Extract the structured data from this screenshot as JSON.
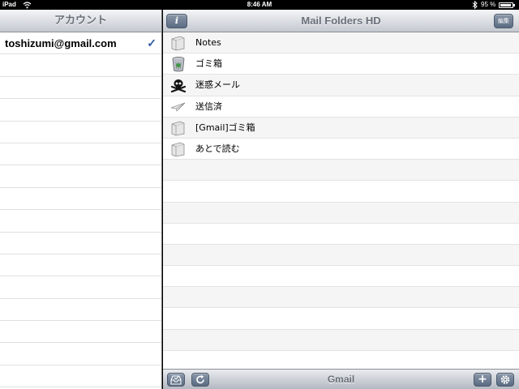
{
  "status_bar": {
    "device": "iPad",
    "time": "8:46 AM",
    "battery": "95 %"
  },
  "accounts_pane": {
    "title": "アカウント",
    "accounts": [
      {
        "label": "toshizumi@gmail.com",
        "checkmark": "✓",
        "selected": true
      }
    ]
  },
  "main": {
    "nav_title": "Mail Folders HD",
    "info_button_label": "i",
    "edit_button_label": "編集",
    "folders": [
      {
        "label": "Notes",
        "icon": "folder-icon"
      },
      {
        "label": "ゴミ箱",
        "icon": "trash-icon"
      },
      {
        "label": "迷惑メール",
        "icon": "skull-icon"
      },
      {
        "label": "送信済",
        "icon": "paper-plane-icon"
      },
      {
        "label": "[Gmail]ゴミ箱",
        "icon": "folder-icon"
      },
      {
        "label": "あとで読む",
        "icon": "folder-icon"
      }
    ],
    "toolbar": {
      "title": "Gmail",
      "add_button_label": "+"
    }
  },
  "colors": {
    "bar_text": "#6a7079",
    "button": "#5a6b82",
    "checkmark": "#2c5aa0"
  }
}
